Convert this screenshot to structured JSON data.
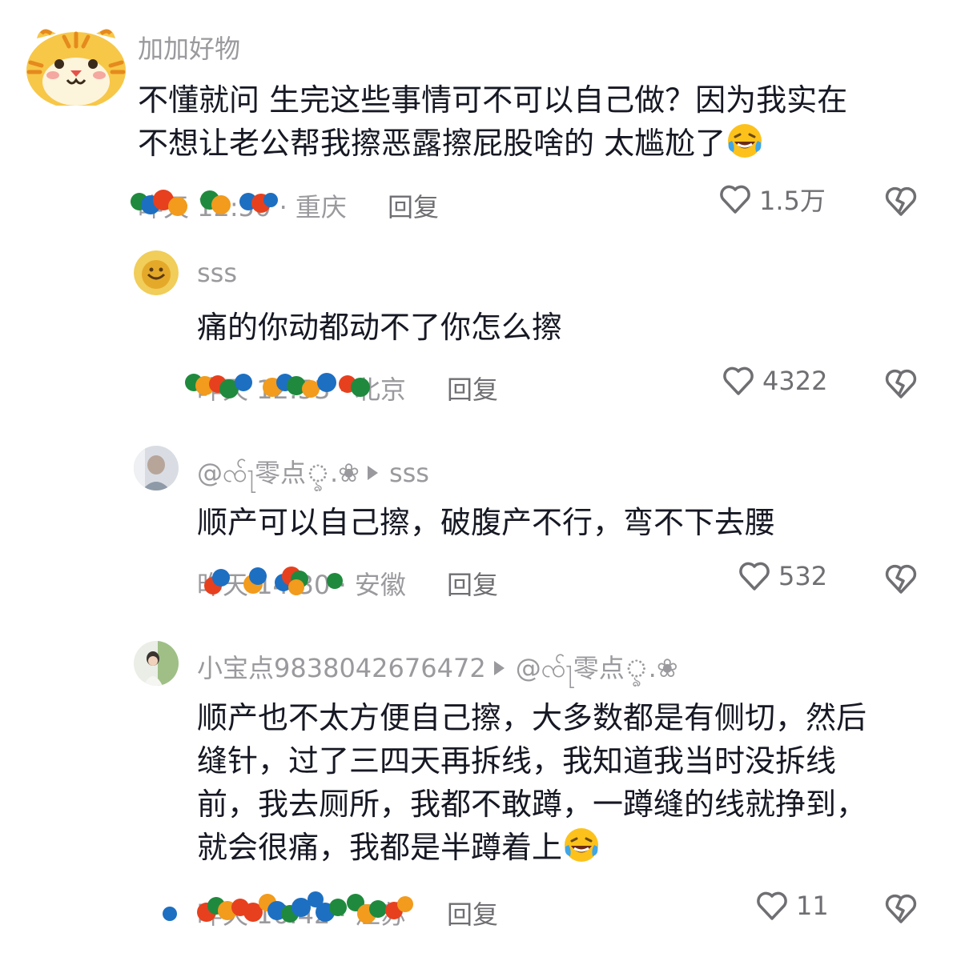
{
  "comments": [
    {
      "username": "加加好物",
      "lines": [
        "不懂就问 生完这些事情可不可以自己做？因为我实在",
        "不想让老公帮我擦恶露擦屁股啥的 太尴尬了"
      ],
      "meta": "昨天 12:50 · 重庆",
      "reply_label": "回复",
      "likes": "1.5万",
      "avatar": "tiger-avatar"
    },
    {
      "username": "sss",
      "lines": [
        "痛的你动都动不了你怎么擦"
      ],
      "meta": "昨天 12:53 · 北京",
      "reply_label": "回复",
      "likes": "4322",
      "avatar": "yellow-face-avatar"
    },
    {
      "username": "@ၸ်ႃ零点ৢ.❀",
      "reply_to": "sss",
      "lines": [
        "顺产可以自己擦，破腹产不行，弯不下去腰"
      ],
      "meta": "昨天 14:30 · 安徽",
      "reply_label": "回复",
      "likes": "532",
      "avatar": "girl-photo-avatar"
    },
    {
      "username": "小宝点9838042676472",
      "reply_to": "@ၸ်ႃ零点ৢ.❀",
      "lines": [
        "顺产也不太方便自己擦，大多数都是有侧切，然后",
        "缝针，过了三四天再拆线，我知道我当时没拆线",
        "前，我去厕所，我都不敢蹲，一蹲缝的线就挣到，",
        "就会很痛，我都是半蹲着上"
      ],
      "meta": "昨天 16:42 · 江苏",
      "reply_label": "回复",
      "likes": "11",
      "avatar": "child-photo-avatar"
    }
  ],
  "icons": {
    "heart": "heart-outline-icon",
    "dislike": "broken-heart-icon",
    "emoji": "laughing-crying-emoji"
  },
  "colors": {
    "text": "#161823",
    "muted": "#9a9a9e",
    "action": "#6f6f73"
  }
}
